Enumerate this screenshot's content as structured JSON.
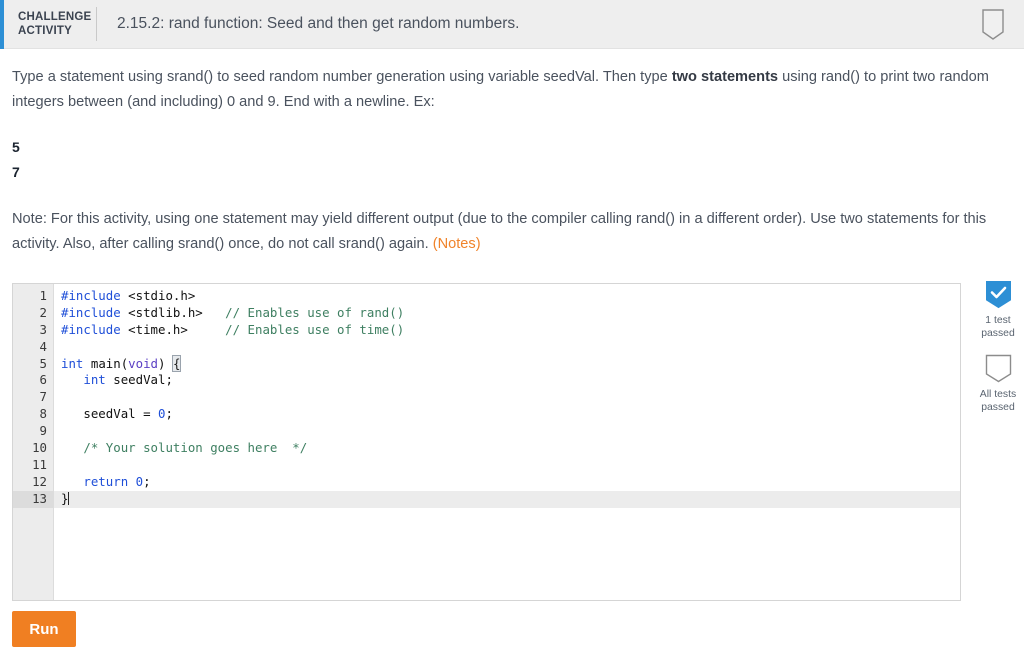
{
  "header": {
    "challenge_line1": "CHALLENGE",
    "challenge_line2": "ACTIVITY",
    "title": "2.15.2: rand function: Seed and then get random numbers.",
    "accent_color": "#2d8fd5",
    "award_icon": "award-shield-icon"
  },
  "instructions": {
    "para1_a": "Type a statement using srand() to seed random number generation using variable seedVal. Then type ",
    "para1_bold": "two statements",
    "para1_b": " using rand() to print two random integers between (and including) 0 and 9. End with a newline. Ex:",
    "example_line1": "5",
    "example_line2": "7",
    "para2_a": "Note: For this activity, using one statement may yield different output (due to the compiler calling rand() in a different order). Use two statements for this activity. Also, after calling srand() once, do not call srand() again. ",
    "notes_link": "(Notes)",
    "notes_link_color": "#f0832a"
  },
  "editor": {
    "line_numbers": [
      "1",
      "2",
      "3",
      "4",
      "5",
      "6",
      "7",
      "8",
      "9",
      "10",
      "11",
      "12",
      "13"
    ],
    "active_line": 13,
    "lines": [
      {
        "n": 1,
        "tokens": [
          {
            "t": "#include",
            "c": "tok-pre"
          },
          {
            "t": " ",
            "c": "tok-plain"
          },
          {
            "t": "<stdio.h>",
            "c": "tok-inc"
          }
        ]
      },
      {
        "n": 2,
        "tokens": [
          {
            "t": "#include",
            "c": "tok-pre"
          },
          {
            "t": " ",
            "c": "tok-plain"
          },
          {
            "t": "<stdlib.h>",
            "c": "tok-inc"
          },
          {
            "t": "   ",
            "c": "tok-plain"
          },
          {
            "t": "// Enables use of rand()",
            "c": "tok-cmt"
          }
        ]
      },
      {
        "n": 3,
        "tokens": [
          {
            "t": "#include",
            "c": "tok-pre"
          },
          {
            "t": " ",
            "c": "tok-plain"
          },
          {
            "t": "<time.h>",
            "c": "tok-inc"
          },
          {
            "t": "     ",
            "c": "tok-plain"
          },
          {
            "t": "// Enables use of time()",
            "c": "tok-cmt"
          }
        ]
      },
      {
        "n": 4,
        "tokens": []
      },
      {
        "n": 5,
        "tokens": [
          {
            "t": "int",
            "c": "tok-kw"
          },
          {
            "t": " ",
            "c": "tok-plain"
          },
          {
            "t": "main",
            "c": "tok-id"
          },
          {
            "t": "(",
            "c": "tok-plain"
          },
          {
            "t": "void",
            "c": "tok-type"
          },
          {
            "t": ") ",
            "c": "tok-plain"
          },
          {
            "t": "{",
            "c": "brace-match"
          }
        ]
      },
      {
        "n": 6,
        "tokens": [
          {
            "t": "   ",
            "c": "tok-plain"
          },
          {
            "t": "int",
            "c": "tok-kw"
          },
          {
            "t": " ",
            "c": "tok-plain"
          },
          {
            "t": "seedVal;",
            "c": "tok-id"
          }
        ]
      },
      {
        "n": 7,
        "tokens": []
      },
      {
        "n": 8,
        "tokens": [
          {
            "t": "   ",
            "c": "tok-plain"
          },
          {
            "t": "seedVal = ",
            "c": "tok-id"
          },
          {
            "t": "0",
            "c": "tok-num"
          },
          {
            "t": ";",
            "c": "tok-plain"
          }
        ]
      },
      {
        "n": 9,
        "tokens": []
      },
      {
        "n": 10,
        "tokens": [
          {
            "t": "   ",
            "c": "tok-plain"
          },
          {
            "t": "/* Your solution goes here  */",
            "c": "tok-cmt"
          }
        ]
      },
      {
        "n": 11,
        "tokens": []
      },
      {
        "n": 12,
        "tokens": [
          {
            "t": "   ",
            "c": "tok-plain"
          },
          {
            "t": "return",
            "c": "tok-kw"
          },
          {
            "t": " ",
            "c": "tok-plain"
          },
          {
            "t": "0",
            "c": "tok-num"
          },
          {
            "t": ";",
            "c": "tok-plain"
          }
        ]
      },
      {
        "n": 13,
        "tokens": [
          {
            "t": "}",
            "c": "tok-plain"
          }
        ],
        "caret": true
      }
    ]
  },
  "tests": [
    {
      "icon": "shield-check-icon",
      "state": "passed",
      "caption": "1 test passed",
      "color": "#2d8fd5"
    },
    {
      "icon": "shield-outline-icon",
      "state": "empty",
      "caption": "All tests passed",
      "color": "#8c8c8c"
    }
  ],
  "run_button": {
    "label": "Run",
    "color": "#f07f22"
  }
}
